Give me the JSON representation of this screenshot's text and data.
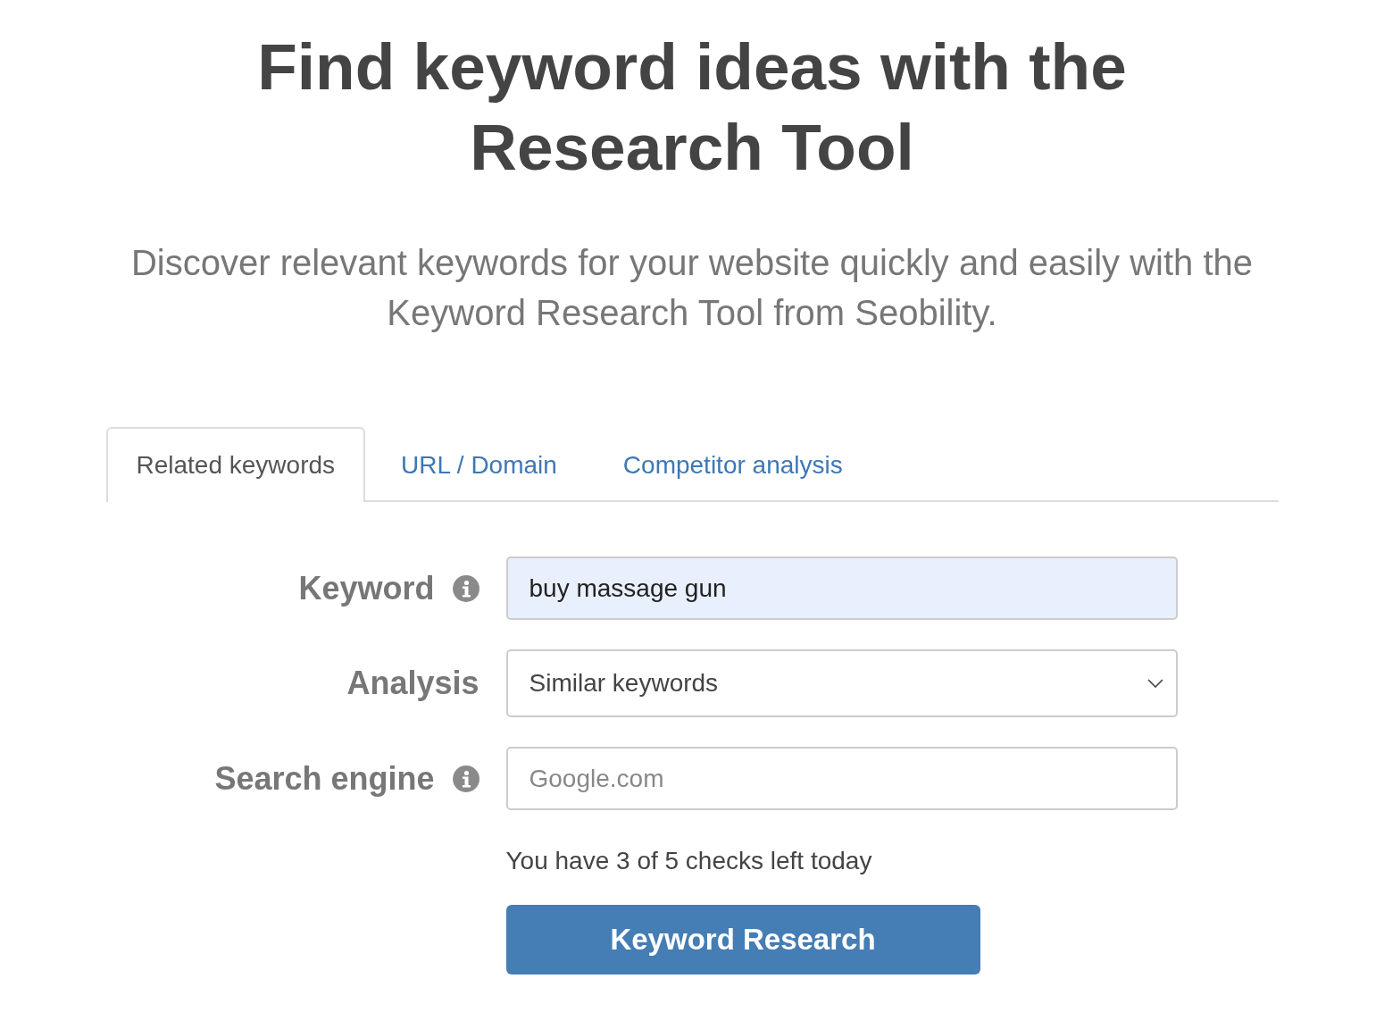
{
  "heading": {
    "title": "Find keyword ideas with the Research Tool",
    "subtitle": "Discover relevant keywords for your website quickly and easily with the Keyword Research Tool from Seobility."
  },
  "tabs": [
    {
      "label": "Related keywords",
      "selected": true
    },
    {
      "label": "URL / Domain",
      "selected": false
    },
    {
      "label": "Competitor analysis",
      "selected": false
    }
  ],
  "form": {
    "rows": [
      {
        "label": "Keyword",
        "info": true,
        "kind": "text",
        "value": "buy massage gun",
        "autofilled": true
      },
      {
        "label": "Analysis",
        "info": false,
        "kind": "select",
        "value": "Similar keywords"
      },
      {
        "label": "Search engine",
        "info": true,
        "kind": "text",
        "placeholder": "Google.com",
        "autofilled": false
      }
    ],
    "quota": "You have 3 of 5 checks left today",
    "submit": "Keyword Research"
  }
}
